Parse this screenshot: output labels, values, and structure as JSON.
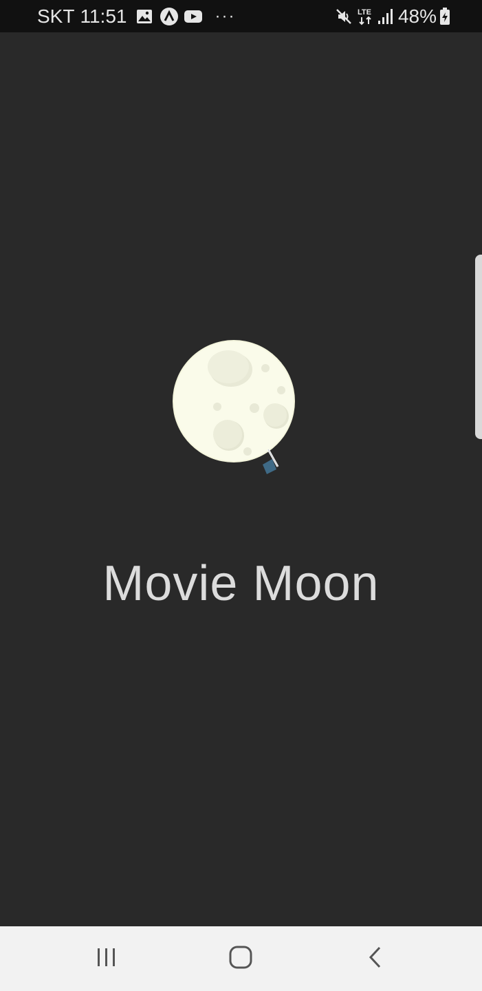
{
  "status_bar": {
    "carrier": "SKT",
    "time": "11:51",
    "notification_icons": [
      "gallery-icon",
      "app-icon",
      "youtube-icon",
      "more-icon"
    ],
    "more": "···",
    "network": "LTE",
    "battery": "48%"
  },
  "app": {
    "title": "Movie Moon",
    "colors": {
      "background": "#292929",
      "moon": "#f7f8e6",
      "crater": "#e6e7d4",
      "flag": "#3f6a86",
      "title": "#dcdcdc"
    }
  },
  "nav_bar": {
    "buttons": [
      "recents-icon",
      "home-icon",
      "back-icon"
    ]
  }
}
